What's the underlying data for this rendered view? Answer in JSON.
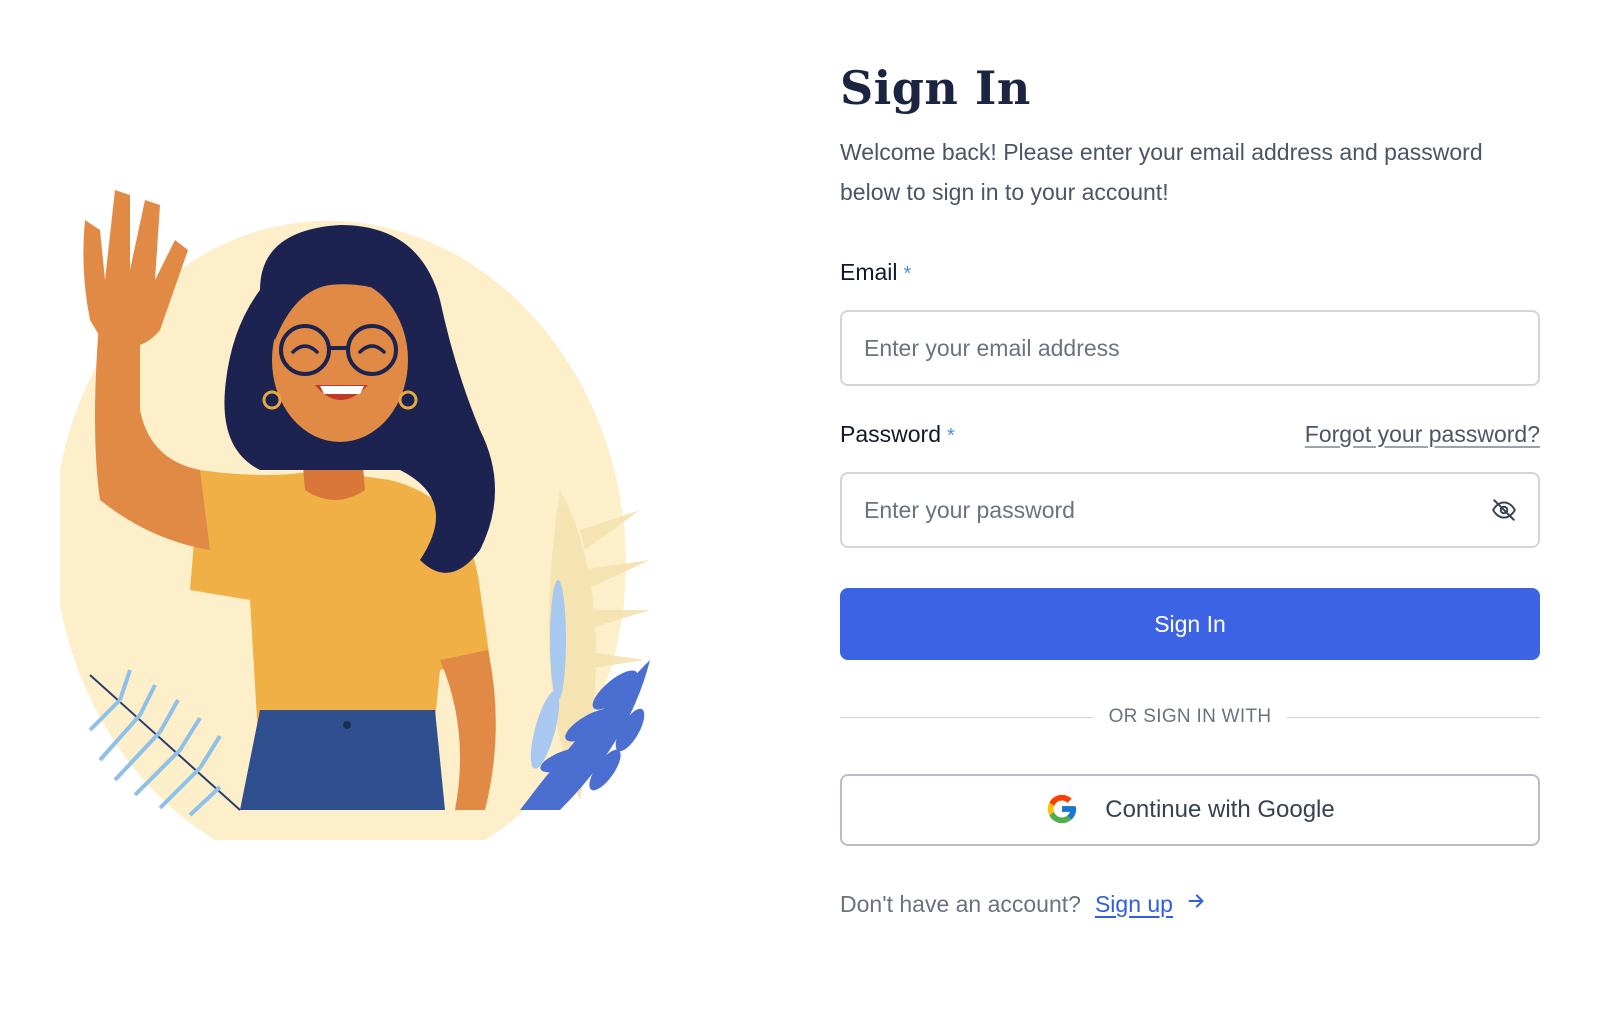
{
  "page": {
    "title": "Sign In",
    "subtitle": "Welcome back! Please enter your email address and password below to sign in to your account!"
  },
  "form": {
    "email": {
      "label": "Email",
      "required_marker": "*",
      "placeholder": "Enter your email address",
      "value": ""
    },
    "password": {
      "label": "Password",
      "required_marker": "*",
      "placeholder": "Enter your password",
      "value": "",
      "forgot_link": "Forgot your password?",
      "toggle_icon": "eye-off-icon"
    },
    "submit_label": "Sign In",
    "divider_text": "OR SIGN IN WITH",
    "google_label": "Continue with Google",
    "signup_prompt": "Don't have an account?",
    "signup_link": "Sign up"
  },
  "colors": {
    "primary": "#3b63e3",
    "title": "#1b2440",
    "required": "#4a8fe0",
    "illustration_bg": "#fcefc9"
  }
}
